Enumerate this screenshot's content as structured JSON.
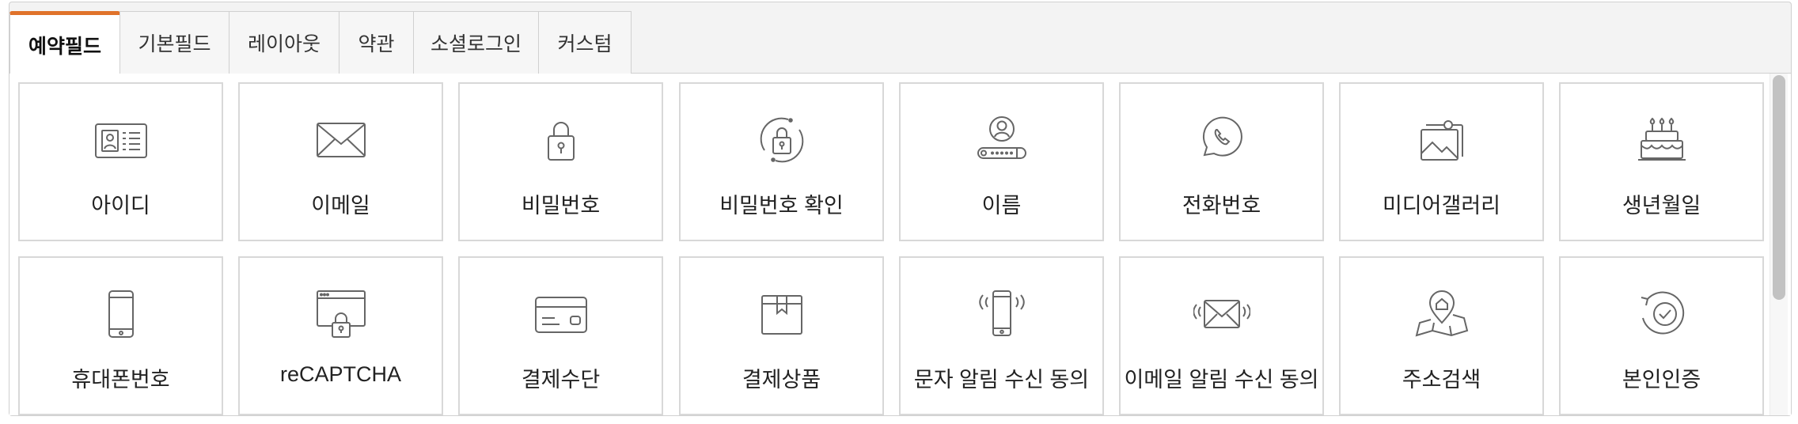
{
  "tabs": [
    {
      "label": "예약필드",
      "active": true
    },
    {
      "label": "기본필드",
      "active": false
    },
    {
      "label": "레이아웃",
      "active": false
    },
    {
      "label": "약관",
      "active": false
    },
    {
      "label": "소셜로그인",
      "active": false
    },
    {
      "label": "커스텀",
      "active": false
    }
  ],
  "fields": [
    {
      "label": "아이디",
      "icon": "id-card-icon"
    },
    {
      "label": "이메일",
      "icon": "envelope-icon"
    },
    {
      "label": "비밀번호",
      "icon": "padlock-icon"
    },
    {
      "label": "비밀번호 확인",
      "icon": "padlock-refresh-icon"
    },
    {
      "label": "이름",
      "icon": "user-name-icon"
    },
    {
      "label": "전화번호",
      "icon": "phone-bubble-icon"
    },
    {
      "label": "미디어갤러리",
      "icon": "image-gallery-icon"
    },
    {
      "label": "생년월일",
      "icon": "birthday-cake-icon"
    },
    {
      "label": "휴대폰번호",
      "icon": "mobile-phone-icon"
    },
    {
      "label": "reCAPTCHA",
      "icon": "browser-lock-icon"
    },
    {
      "label": "결제수단",
      "icon": "credit-card-icon"
    },
    {
      "label": "결제상품",
      "icon": "package-box-icon"
    },
    {
      "label": "문자 알림 수신 동의",
      "icon": "phone-vibrate-icon"
    },
    {
      "label": "이메일 알림 수신 동의",
      "icon": "envelope-vibrate-icon"
    },
    {
      "label": "주소검색",
      "icon": "map-pin-icon"
    },
    {
      "label": "본인인증",
      "icon": "verify-check-icon"
    }
  ],
  "colors": {
    "accent": "#e0722a",
    "icon_stroke": "#666666",
    "tile_border": "#d8d8d8"
  }
}
